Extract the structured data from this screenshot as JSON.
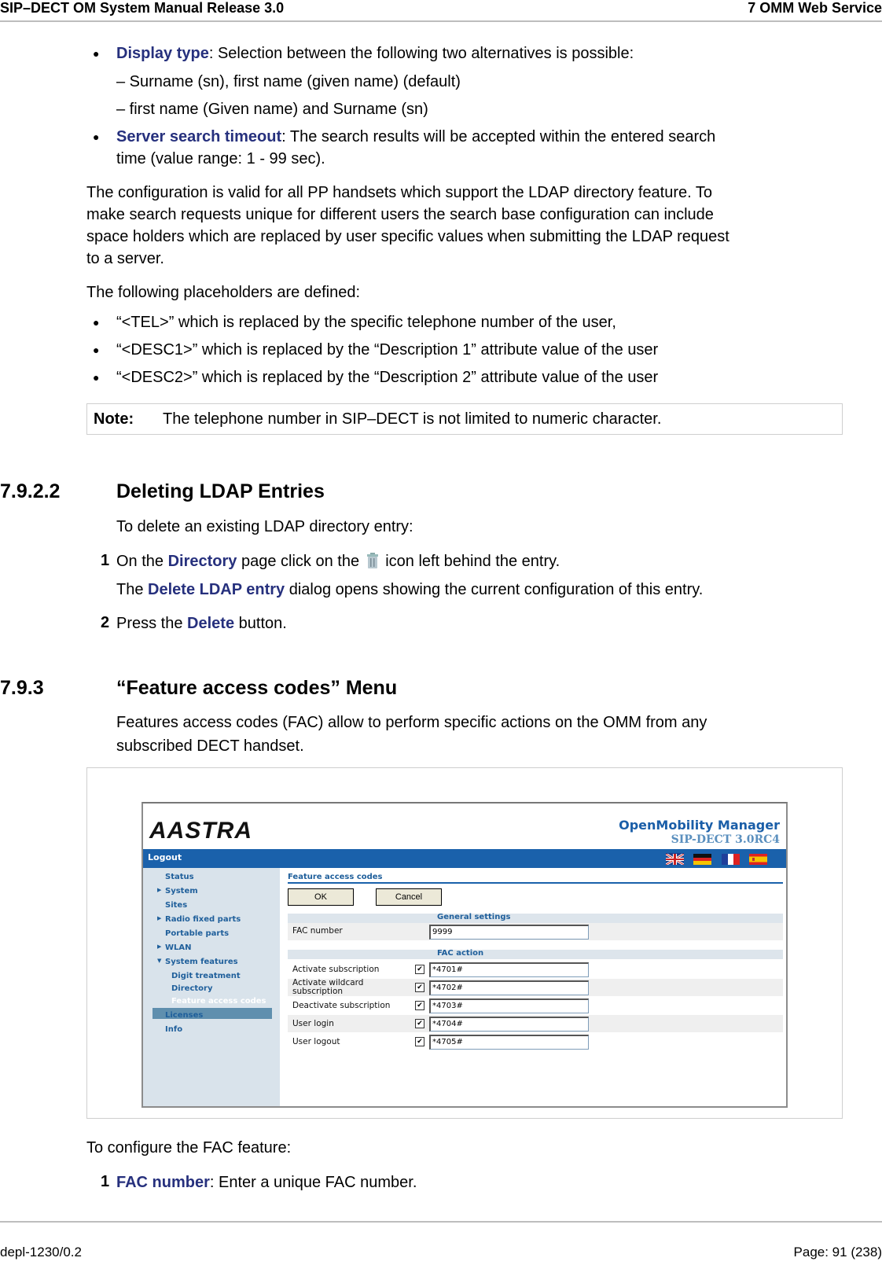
{
  "header": {
    "left": "SIP–DECT OM System Manual Release 3.0",
    "right": "7 OMM Web Service"
  },
  "bullets_top": [
    {
      "term": "Display type",
      "text": ": Selection between the following two alternatives is possible:"
    },
    {
      "term": "Server search timeout",
      "text": ": The search results will be accepted within the entered search",
      "text2": "time (value range: 1 - 99 sec)."
    }
  ],
  "display_options": [
    "– Surname (sn), first name (given name) (default)",
    "– first name (Given name) and Surname (sn)"
  ],
  "para1": [
    "The configuration is valid for all PP handsets which support the LDAP directory feature. To",
    "make search requests unique for different users the search base configuration can include",
    "space holders which are replaced by user specific values when submitting the LDAP request",
    "to a server."
  ],
  "para2": "The following placeholders are defined:",
  "placeholders": [
    "“<TEL>” which is replaced by the specific telephone number of the user,",
    "“<DESC1>” which is replaced by the “Description 1” attribute value of the user",
    "“<DESC2>” which is replaced by the “Description 2” attribute value of the user"
  ],
  "note": {
    "label": "Note:",
    "text": "The telephone number in SIP–DECT is not limited to numeric character."
  },
  "section1": {
    "number": "7.9.2.2",
    "title": "Deleting LDAP Entries",
    "intro": "To delete an existing LDAP directory entry:",
    "steps": [
      {
        "n": "1",
        "pre": "On the ",
        "kw": "Directory",
        "mid": " page click on the ",
        "post": " icon left behind the entry.",
        "sub_pre": "The ",
        "sub_kw": "Delete LDAP entry",
        "sub_post": " dialog opens showing the current configuration of this entry."
      },
      {
        "n": "2",
        "pre": "Press the ",
        "kw": "Delete",
        "post": " button."
      }
    ]
  },
  "section2": {
    "number": "7.9.3",
    "title": "“Feature access codes” Menu",
    "intro": [
      "Features access codes (FAC) allow to perform specific actions on the OMM from any",
      "subscribed DECT handset."
    ]
  },
  "omm": {
    "logo": "AASTRA",
    "title": "OpenMobility Manager",
    "version": "SIP-DECT 3.0RC4",
    "logout": "Logout",
    "flags": [
      "uk-flag",
      "de-flag",
      "fr-flag",
      "es-flag"
    ],
    "nav": [
      {
        "label": "Status",
        "arrow": ""
      },
      {
        "label": "System",
        "arrow": "▶"
      },
      {
        "label": "Sites",
        "arrow": ""
      },
      {
        "label": "Radio fixed parts",
        "arrow": "▶"
      },
      {
        "label": "Portable parts",
        "arrow": ""
      },
      {
        "label": "WLAN",
        "arrow": "▶"
      },
      {
        "label": "System features",
        "arrow": "▼"
      },
      {
        "label": "Digit treatment",
        "sub": true
      },
      {
        "label": "Directory",
        "sub": true
      },
      {
        "label": "Feature access codes",
        "sub": true,
        "selected": true
      },
      {
        "label": "Licenses",
        "arrow": ""
      },
      {
        "label": "Info",
        "arrow": ""
      }
    ],
    "page_title": "Feature access codes",
    "ok": "OK",
    "cancel": "Cancel",
    "general_settings": "General settings",
    "fac_number_label": "FAC number",
    "fac_number_value": "9999",
    "fac_action": "FAC action",
    "actions": [
      {
        "label": "Activate subscription",
        "checked": true,
        "code": "*4701#"
      },
      {
        "label": "Activate wildcard subscription",
        "checked": true,
        "code": "*4702#"
      },
      {
        "label": "Deactivate subscription",
        "checked": true,
        "code": "*4703#"
      },
      {
        "label": "User login",
        "checked": true,
        "code": "*4704#"
      },
      {
        "label": "User logout",
        "checked": true,
        "code": "*4705#"
      }
    ]
  },
  "configure": {
    "intro": "To configure the FAC feature:",
    "steps": [
      {
        "n": "1",
        "kw": "FAC number",
        "text": ": Enter a unique FAC number."
      }
    ]
  },
  "footer": {
    "left": "depl-1230/0.2",
    "right": "Page: 91 (238)"
  },
  "colors": {
    "keyword": "#26307d",
    "omm_blue": "#1a61ab",
    "sidebar": "#d9e3eb"
  }
}
